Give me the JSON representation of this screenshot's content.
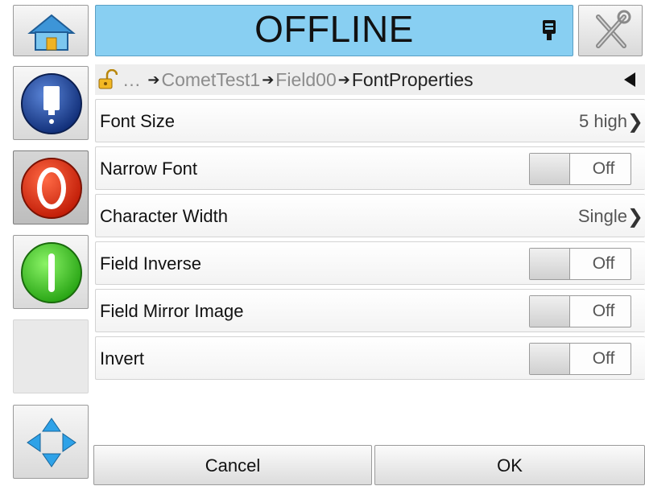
{
  "status": {
    "text": "OFFLINE"
  },
  "icons": {
    "home": "home-icon",
    "tools": "tools-icon",
    "printhead": "printhead-icon",
    "ink": "ink-bottle-icon",
    "stop": "stop-icon",
    "start": "start-icon",
    "navigate": "navigation-arrows-icon",
    "lock": "unlocked-padlock-icon",
    "back": "back-triangle-icon"
  },
  "breadcrumb": {
    "ellipsis": "…",
    "items": [
      "CometTest1",
      "Field00",
      "FontProperties"
    ],
    "arrow": "➔"
  },
  "rows": [
    {
      "label": "Font Size",
      "type": "select",
      "value": "5 high"
    },
    {
      "label": "Narrow Font",
      "type": "toggle",
      "value": "Off"
    },
    {
      "label": "Character Width",
      "type": "select",
      "value": "Single"
    },
    {
      "label": "Field Inverse",
      "type": "toggle",
      "value": "Off"
    },
    {
      "label": "Field Mirror Image",
      "type": "toggle",
      "value": "Off"
    },
    {
      "label": "Invert",
      "type": "toggle",
      "value": "Off"
    }
  ],
  "footer": {
    "cancel": "Cancel",
    "ok": "OK"
  },
  "colors": {
    "status_bg": "#88cff2",
    "stop_red": "#e23c1c",
    "start_green": "#4cd42a",
    "ink_blue": "#1f4fb0",
    "nav_blue": "#2ea2e8"
  }
}
